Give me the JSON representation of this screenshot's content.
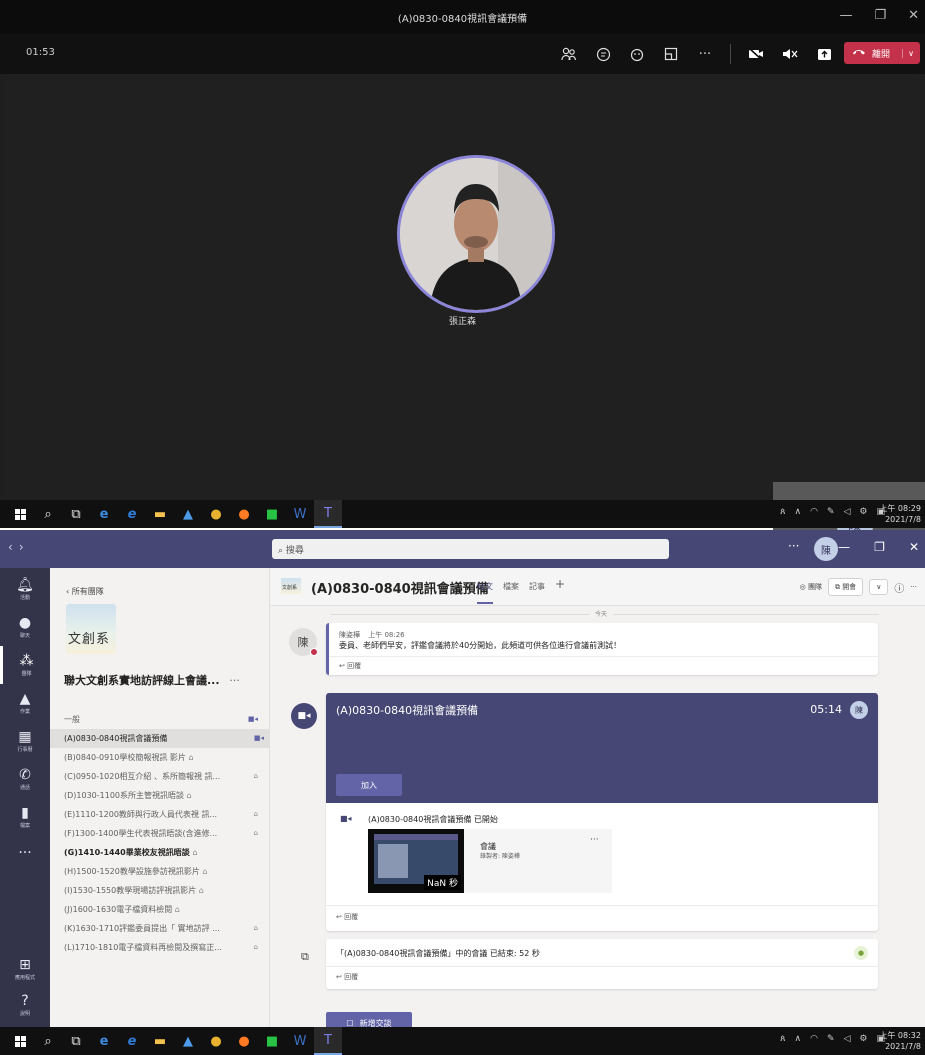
{
  "meeting": {
    "window_title": "(A)0830-0840視訊會議預備",
    "timer": "01:53",
    "leave_label": "離開",
    "participant_name": "張正森",
    "self_initial": "陳"
  },
  "taskbar_top": {
    "time": "上午 08:29",
    "date": "2021/7/8"
  },
  "taskbar_bottom": {
    "time": "上午 08:32",
    "date": "2021/7/8"
  },
  "teams": {
    "search_placeholder": "搜尋",
    "me_initial": "陳",
    "rail": [
      {
        "label": "活動",
        "icon": "bell-icon"
      },
      {
        "label": "聊天",
        "icon": "chat-icon"
      },
      {
        "label": "團隊",
        "icon": "teams-icon"
      },
      {
        "label": "作業",
        "icon": "assignments-icon"
      },
      {
        "label": "行事曆",
        "icon": "calendar-icon"
      },
      {
        "label": "通話",
        "icon": "phone-icon"
      },
      {
        "label": "檔案",
        "icon": "file-icon"
      },
      {
        "label": "應用程式",
        "icon": "apps-icon"
      },
      {
        "label": "說明",
        "icon": "help-icon"
      }
    ],
    "back_label": "所有團隊",
    "logo_text": "文創系",
    "team_name": "聯大文創系實地訪評線上會議...",
    "channels": [
      {
        "label": "一般"
      },
      {
        "label": "(A)0830-0840視訊會議預備"
      },
      {
        "label": "(B)0840-0910學校簡報視訊 影片"
      },
      {
        "label": "(C)0950-1020相互介紹 、系所簡報視 訊..."
      },
      {
        "label": "(D)1030-1100系所主管視訊晤談"
      },
      {
        "label": "(E)1110-1200教師與行政人員代表視 訊..."
      },
      {
        "label": "(F)1300-1400學生代表視訊晤談(含進修..."
      },
      {
        "label": "(G)1410-1440畢業校友視訊晤談"
      },
      {
        "label": "(H)1500-1520教學設施參訪視訊影片"
      },
      {
        "label": "(I)1530-1550教學現場訪評視訊影片"
      },
      {
        "label": "(J)1600-1630電子檔資料檢閱"
      },
      {
        "label": "(K)1630-1710評鑑委員提出「 實地訪評 ..."
      },
      {
        "label": "(L)1710-1810電子檔資料再檢閱及撰寫正..."
      }
    ],
    "channel_header": {
      "logo_text": "文創系",
      "title": "(A)0830-0840視訊會議預備",
      "tabs": [
        "貼文",
        "檔案",
        "記事"
      ],
      "add_tab": "+",
      "team_btn": "團隊",
      "meet_btn": "開會",
      "info": "ⓘ",
      "more": "···"
    },
    "today_label": "今天",
    "post1": {
      "avatar": "陳",
      "author": "陳姿樺",
      "time": "上午 08:26",
      "body": "委員、老師們早安，評鑑會議將於40分開始，此頻道可供各位進行會議前測試！",
      "reply": "回覆"
    },
    "meeting_card": {
      "title": "(A)0830-0840視訊會議預備",
      "timer": "05:14",
      "avatar": "陳",
      "join_label": "加入",
      "started": "(A)0830-0840視訊會議預備 已開始",
      "rec_duration": "NaN 秒",
      "rec_label": "會議",
      "rec_by": "錄製者: 陳姿樺",
      "rec_more": "···",
      "reply": "回覆"
    },
    "end_card": {
      "text": "「(A)0830-0840視訊會議預備」中的會議 已結束: 52 秒",
      "reply": "回覆"
    },
    "new_conversation": "新增交談"
  },
  "colors": {
    "teams_purple": "#464775",
    "accent": "#6264a7",
    "leave_red": "#c4314b"
  }
}
